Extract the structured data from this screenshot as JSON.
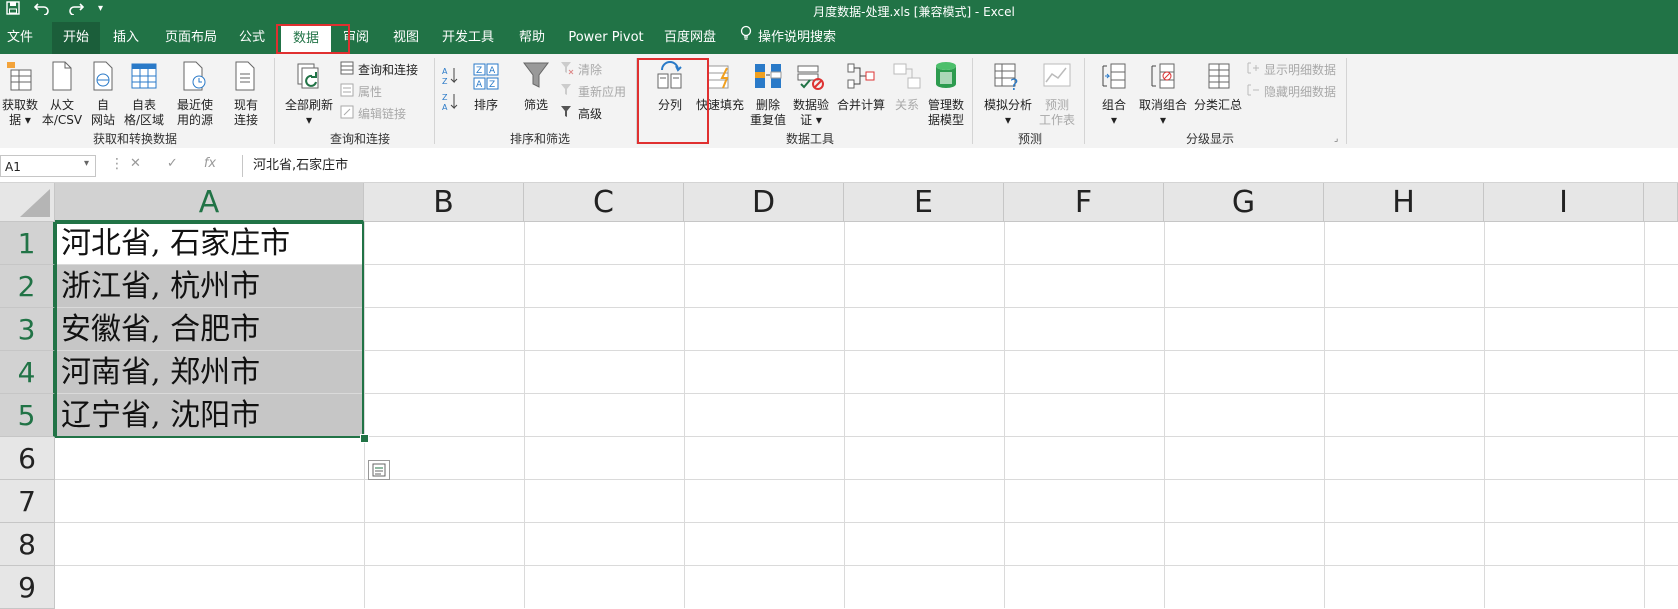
{
  "window": {
    "title": "月度数据-处理.xls  [兼容模式]  -  Excel",
    "qat": {
      "save_icon": "save-icon",
      "undo_icon": "undo-icon",
      "redo_icon": "redo-icon",
      "customize_icon": "chevron-down-icon"
    }
  },
  "tabs": [
    {
      "label": "文件"
    },
    {
      "label": "开始"
    },
    {
      "label": "插入"
    },
    {
      "label": "页面布局"
    },
    {
      "label": "公式"
    },
    {
      "label": "数据"
    },
    {
      "label": "审阅"
    },
    {
      "label": "视图"
    },
    {
      "label": "开发工具"
    },
    {
      "label": "帮助"
    },
    {
      "label": "Power Pivot"
    },
    {
      "label": "百度网盘"
    },
    {
      "label": "操作说明搜索"
    }
  ],
  "ribbon": {
    "get_transform": {
      "label": "获取和转换数据",
      "get_data": [
        "获取数",
        "据 ▾"
      ],
      "from_csv": [
        "从文",
        "本/CSV"
      ],
      "from_web": [
        "自",
        "网站"
      ],
      "from_table": [
        "自表",
        "格/区域"
      ],
      "recent_sources": [
        "最近使",
        "用的源"
      ],
      "existing": [
        "现有",
        "连接"
      ]
    },
    "queries": {
      "label": "查询和连接",
      "refresh_all": [
        "全部刷新",
        "▾"
      ],
      "queries_connections": "查询和连接",
      "properties": "属性",
      "edit_links": "编辑链接"
    },
    "sort_filter": {
      "label": "排序和筛选",
      "sort": "排序",
      "filter": "筛选",
      "clear": "清除",
      "reapply": "重新应用",
      "advanced": "高级"
    },
    "data_tools": {
      "label": "数据工具",
      "text_to_columns": "分列",
      "flash_fill": "快速填充",
      "remove_dupes": [
        "删除",
        "重复值"
      ],
      "validation": [
        "数据验",
        "证 ▾"
      ],
      "consolidate": "合并计算",
      "relationships": "关系",
      "data_model": [
        "管理数",
        "据模型"
      ]
    },
    "forecast": {
      "label": "预测",
      "whatif": [
        "模拟分析",
        "▾"
      ],
      "forecast_sheet": [
        "预测",
        "工作表"
      ]
    },
    "outline": {
      "label": "分级显示",
      "group": [
        "组合",
        "▾"
      ],
      "ungroup": [
        "取消组合",
        "▾"
      ],
      "subtotal": "分类汇总",
      "show_detail": "显示明细数据",
      "hide_detail": "隐藏明细数据"
    }
  },
  "formula_bar": {
    "name_box": "A1",
    "fx": "fx",
    "value": "河北省,石家庄市"
  },
  "sheet": {
    "columns": [
      "A",
      "B",
      "C",
      "D",
      "E",
      "F",
      "G",
      "H",
      "I"
    ],
    "rows": [
      "1",
      "2",
      "3",
      "4",
      "5",
      "6",
      "7",
      "8",
      "9"
    ],
    "cells_A": [
      "河北省, 石家庄市",
      "浙江省, 杭州市",
      "安徽省, 合肥市",
      "河南省, 郑州市",
      "辽宁省, 沈阳市"
    ]
  },
  "colors": {
    "accent": "#217346",
    "highlight": "#e03030"
  }
}
